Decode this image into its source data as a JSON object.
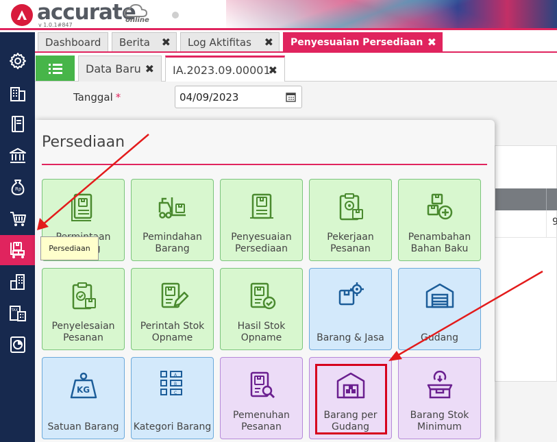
{
  "app": {
    "name": "accurate",
    "suffix": "online",
    "version": "v 1.0.1#847"
  },
  "tabs": [
    {
      "label": "Dashboard"
    },
    {
      "label": "Berita"
    },
    {
      "label": "Log Aktifitas"
    },
    {
      "label": "Penyesuaian Persediaan"
    }
  ],
  "subtabs": [
    {
      "label": "Data Baru"
    },
    {
      "label": "IA.2023.09.00001"
    }
  ],
  "form": {
    "tanggal_label": "Tanggal",
    "required_mark": "*",
    "tanggal_value": "04/09/2023"
  },
  "bg_table": {
    "cell_value": "9"
  },
  "panel": {
    "title": "Persediaan",
    "tiles": [
      {
        "label": "Permintaan Barang",
        "icon": "request-document-icon",
        "color": "green"
      },
      {
        "label": "Pemindahan Barang",
        "icon": "forklift-icon",
        "color": "green"
      },
      {
        "label": "Penyesuaian Persediaan",
        "icon": "inventory-adjust-icon",
        "color": "green"
      },
      {
        "label": "Pekerjaan Pesanan",
        "icon": "work-order-icon",
        "color": "green"
      },
      {
        "label": "Penambahan Bahan Baku",
        "icon": "add-material-icon",
        "color": "green"
      },
      {
        "label": "Penyelesaian Pesanan",
        "icon": "order-complete-icon",
        "color": "green"
      },
      {
        "label": "Perintah Stok Opname",
        "icon": "stock-opname-order-icon",
        "color": "green"
      },
      {
        "label": "Hasil Stok Opname",
        "icon": "stock-opname-result-icon",
        "color": "green"
      },
      {
        "label": "Barang & Jasa",
        "icon": "goods-services-icon",
        "color": "blue"
      },
      {
        "label": "Gudang",
        "icon": "warehouse-icon",
        "color": "blue"
      },
      {
        "label": "Satuan Barang",
        "icon": "weight-kg-icon",
        "color": "blue"
      },
      {
        "label": "Kategori Barang",
        "icon": "category-icon",
        "color": "blue"
      },
      {
        "label": "Pemenuhan Pesanan",
        "icon": "order-fulfillment-icon",
        "color": "purple"
      },
      {
        "label": "Barang per Gudang",
        "icon": "goods-per-warehouse-icon",
        "color": "purple"
      },
      {
        "label": "Barang Stok Minimum",
        "icon": "minimum-stock-icon",
        "color": "purple"
      }
    ]
  },
  "tooltip": {
    "text": "Persediaan"
  },
  "colors": {
    "accent": "#e0245e",
    "sidebar": "#17294e",
    "tile_green": "#d8f7cf",
    "tile_blue": "#d3e9fb",
    "tile_purple": "#ecdcf7",
    "annotation_red": "#d6001c"
  }
}
